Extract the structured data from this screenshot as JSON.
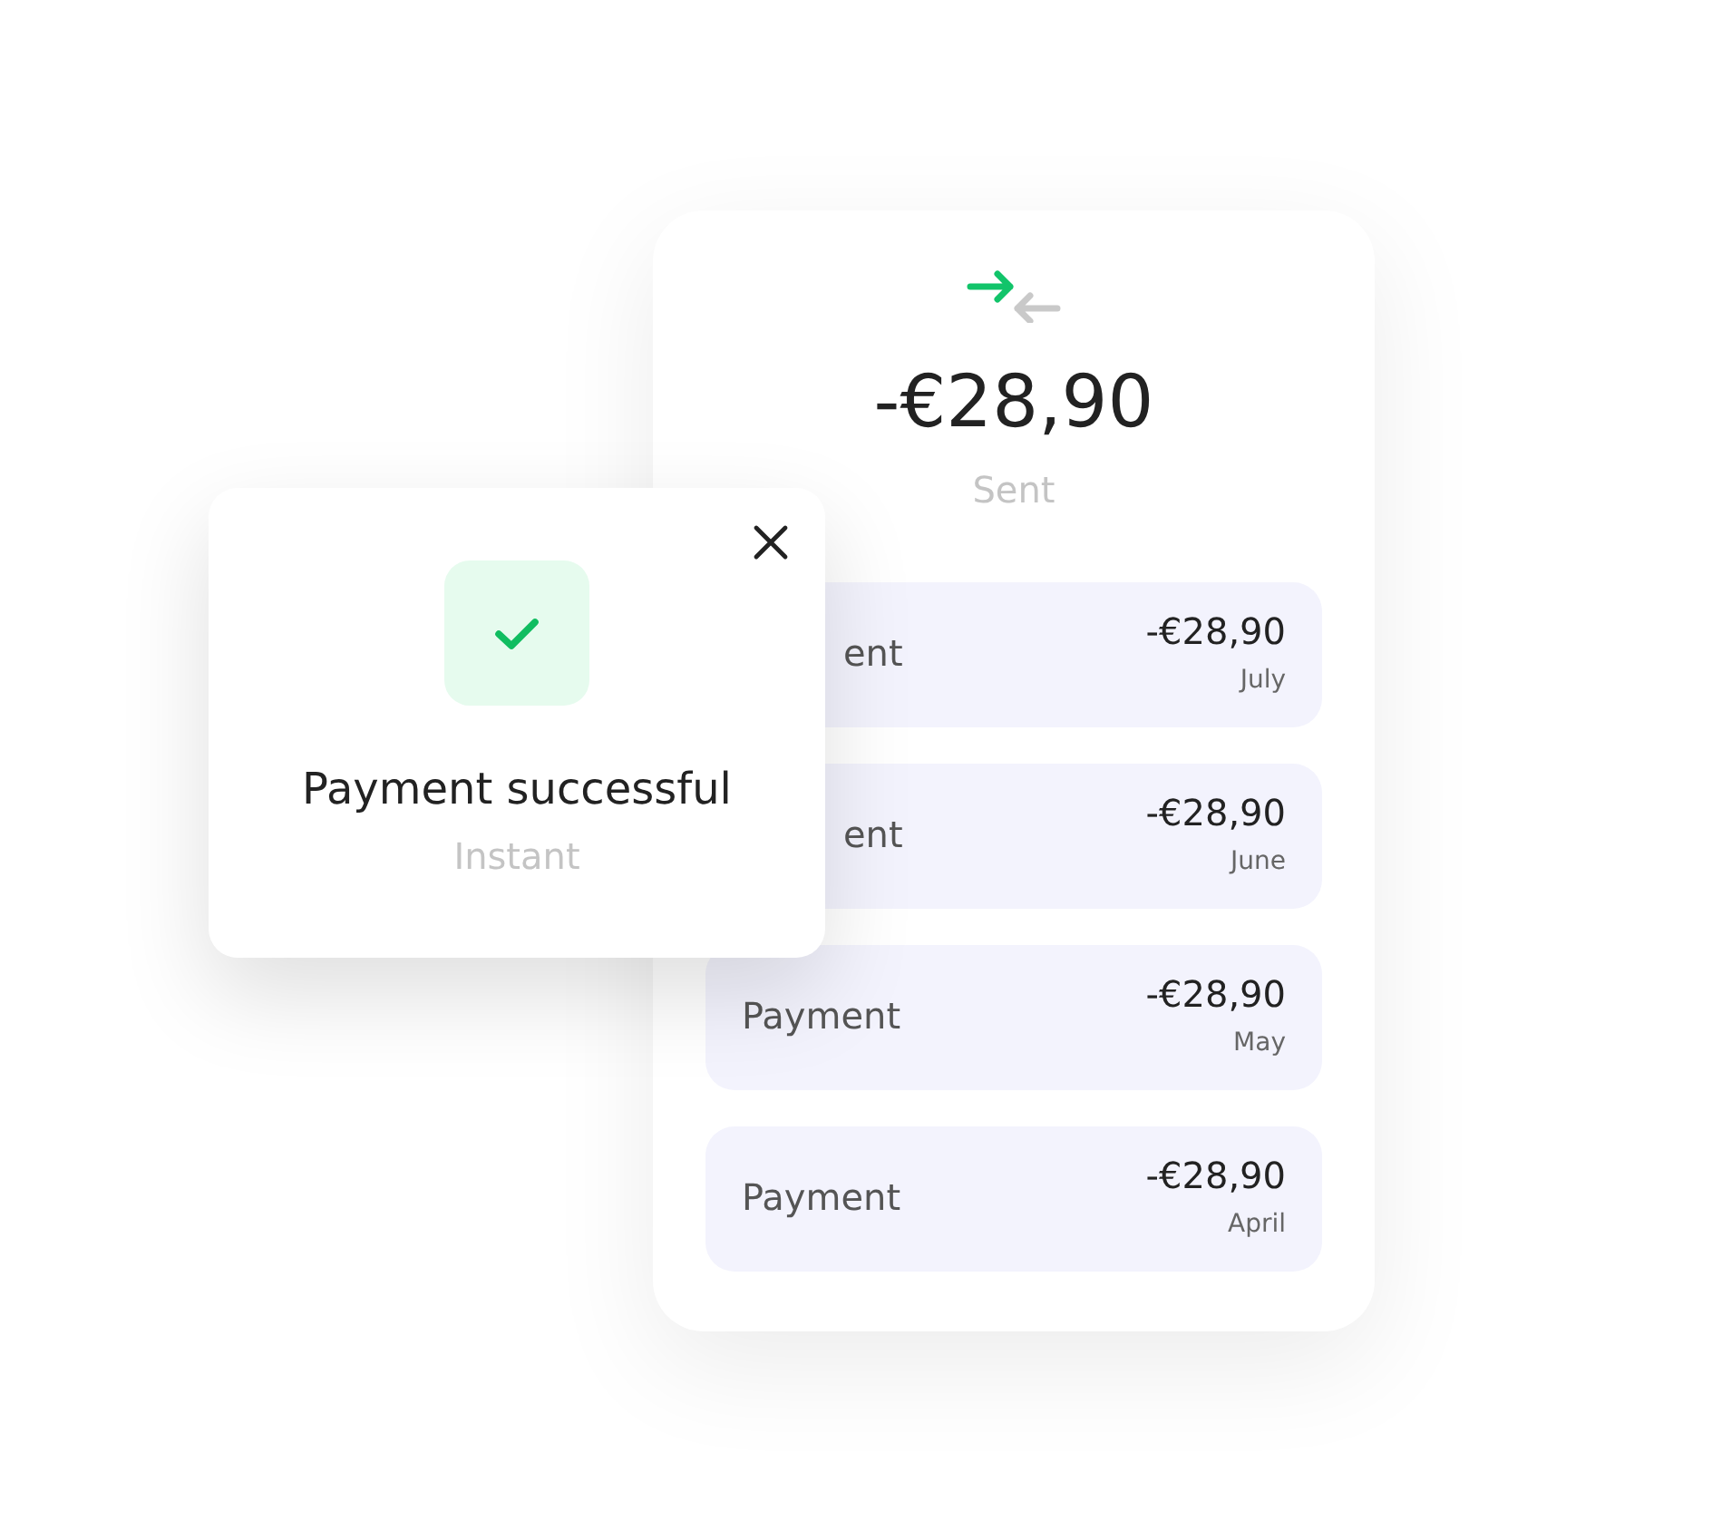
{
  "summary": {
    "amount": "-€28,90",
    "label": "Sent"
  },
  "payments": [
    {
      "label": "ent",
      "covered": true,
      "amount": "-€28,90",
      "month": "July"
    },
    {
      "label": "ent",
      "covered": true,
      "amount": "-€28,90",
      "month": "June"
    },
    {
      "label": "Payment",
      "covered": false,
      "amount": "-€28,90",
      "month": "May"
    },
    {
      "label": "Payment",
      "covered": false,
      "amount": "-€28,90",
      "month": "April"
    }
  ],
  "dialog": {
    "title": "Payment successful",
    "subtitle": "Instant"
  }
}
